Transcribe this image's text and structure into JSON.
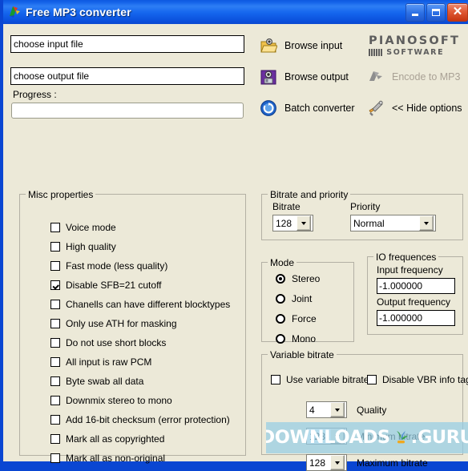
{
  "window": {
    "title": "Free MP3 converter",
    "icon": "app-parrot-icon",
    "controls": {
      "minimize": "minimize-button",
      "maximize": "maximize-button",
      "close": "close-button",
      "close_glyph": "✕"
    },
    "colors": {
      "titlebar_blue": "#1567ee",
      "frame_blue": "#0a46d2",
      "client_background": "#ece9d8",
      "close_red": "#e05a36"
    }
  },
  "top": {
    "input_file_value": "choose input file",
    "output_file_value": "choose output file",
    "input_file_placeholder": "choose input file",
    "output_file_placeholder": "choose output file",
    "progress_label": "Progress :",
    "progress_value": ""
  },
  "toolbar": {
    "browse_input": {
      "label": "Browse input",
      "icon": "folder-open-icon",
      "disabled": false
    },
    "browse_output": {
      "label": "Browse output",
      "icon": "floppy-save-icon",
      "disabled": false
    },
    "batch_converter": {
      "label": "Batch converter",
      "icon": "blue-circle-batch-icon",
      "disabled": false
    },
    "encode": {
      "label": "Encode to MP3",
      "icon": "gray-bird-icon",
      "disabled": true
    },
    "hide_options": {
      "label": "<< Hide options",
      "icon": "tools-icon",
      "disabled": false
    }
  },
  "logo": {
    "line1": "PIANOSOFT",
    "line2": "SOFTWARE",
    "color": "#5d5d5d"
  },
  "misc_properties": {
    "title": "Misc properties",
    "checkboxes": [
      {
        "label": "Voice mode",
        "checked": false
      },
      {
        "label": "High quality",
        "checked": false
      },
      {
        "label": "Fast mode (less quality)",
        "checked": false
      },
      {
        "label": "Disable SFB=21 cutoff",
        "checked": true
      },
      {
        "label": "Chanells can have different blocktypes",
        "checked": false
      },
      {
        "label": "Only use ATH for masking",
        "checked": false
      },
      {
        "label": "Do not use short blocks",
        "checked": false
      },
      {
        "label": "All input is raw PCM",
        "checked": false
      },
      {
        "label": "Byte swab all data",
        "checked": false
      },
      {
        "label": "Downmix stereo to mono",
        "checked": false
      },
      {
        "label": "Add 16-bit checksum (error protection)",
        "checked": false
      },
      {
        "label": "Mark all as copyrighted",
        "checked": false
      },
      {
        "label": "Mark all as non-original",
        "checked": false
      }
    ]
  },
  "bitrate_priority": {
    "title": "Bitrate and priority",
    "bitrate_label": "Bitrate",
    "bitrate_value": "128",
    "priority_label": "Priority",
    "priority_value": "Normal"
  },
  "mode": {
    "title": "Mode",
    "options": [
      {
        "label": "Stereo",
        "selected": true
      },
      {
        "label": "Joint",
        "selected": false
      },
      {
        "label": "Force",
        "selected": false
      },
      {
        "label": "Mono",
        "selected": false
      }
    ]
  },
  "io_frequences": {
    "title": "IO frequences",
    "input_label": "Input frequency",
    "input_value": "-1.000000",
    "output_label": "Output frequency",
    "output_value": "-1.000000"
  },
  "variable_bitrate": {
    "title": "Variable bitrate",
    "use_vbr": {
      "label": "Use variable bitrate",
      "checked": false
    },
    "disable_vbr_tag": {
      "label": "Disable VBR info tag",
      "checked": false
    },
    "quality_label": "Quality",
    "quality_value": "4",
    "minimum_label": "Minimum bitrate",
    "minimum_value": "128",
    "maximum_label": "Maximum bitrate",
    "maximum_value": "128"
  },
  "watermark": {
    "text_left": "DOWNLOADS",
    "text_right": ".GURU",
    "logo": "sprout-logo",
    "band_color": "#96cde4"
  }
}
